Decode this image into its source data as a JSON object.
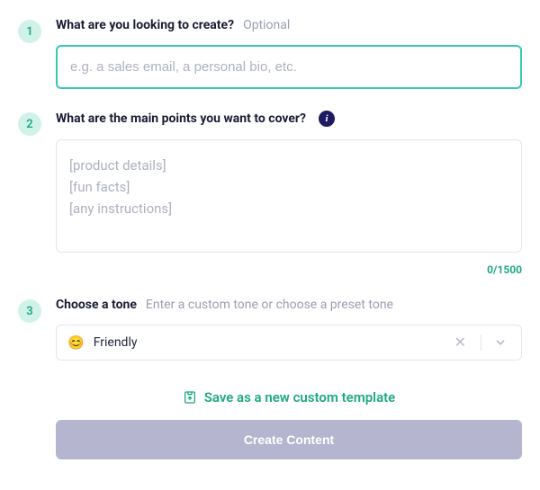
{
  "steps": {
    "create": {
      "number": "1",
      "label": "What are you looking to create?",
      "optional": "Optional",
      "placeholder": "e.g. a sales email, a personal bio, etc."
    },
    "points": {
      "number": "2",
      "label": "What are the main points you want to cover?",
      "placeholder": "[product details]\n[fun facts]\n[any instructions]",
      "counter": "0/1500"
    },
    "tone": {
      "number": "3",
      "label": "Choose a tone",
      "hint": "Enter a custom tone or choose a preset tone",
      "emoji": "😊",
      "value": "Friendly"
    }
  },
  "actions": {
    "save_template": "Save as a new custom template",
    "create_content": "Create Content"
  }
}
